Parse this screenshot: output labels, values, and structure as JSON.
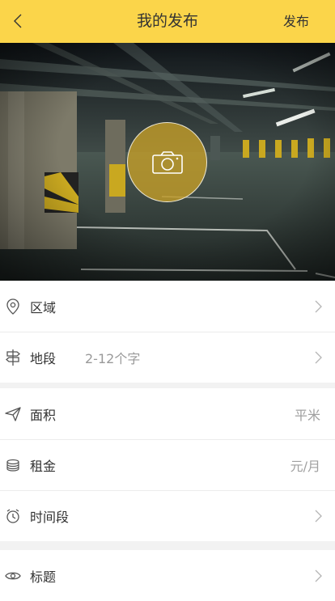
{
  "header": {
    "title": "我的发布",
    "publish_label": "发布"
  },
  "form": {
    "group1": [
      {
        "icon": "location-pin-icon",
        "label": "区域",
        "value": "",
        "unit": ""
      },
      {
        "icon": "signpost-icon",
        "label": "地段",
        "value": "2-12个字",
        "unit": ""
      }
    ],
    "group2": [
      {
        "icon": "paper-plane-icon",
        "label": "面积",
        "value": "",
        "unit": "平米"
      },
      {
        "icon": "coins-icon",
        "label": "租金",
        "value": "",
        "unit": "元/月"
      },
      {
        "icon": "alarm-clock-icon",
        "label": "时间段",
        "value": "",
        "unit": ""
      }
    ],
    "group3": [
      {
        "icon": "eye-icon",
        "label": "标题",
        "value": "",
        "unit": ""
      }
    ]
  },
  "colors": {
    "accent": "#fbd54a",
    "camera_overlay": "#c8a028"
  }
}
